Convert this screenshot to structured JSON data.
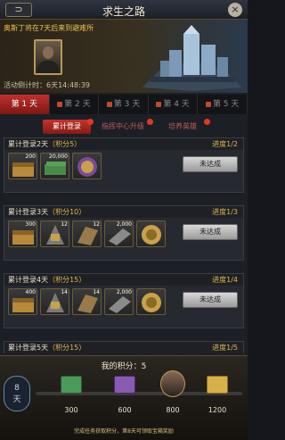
{
  "header": {
    "back_label": "⊃",
    "title": "求生之路",
    "close_label": "×"
  },
  "banner": {
    "message": "奥斯丁将在7天后来到避难所",
    "timer_label": "活动倒计时：",
    "timer_value": "6天14:48:39"
  },
  "day_tabs": [
    {
      "label": "第 1 天",
      "locked": false,
      "active": true
    },
    {
      "label": "第 2 天",
      "locked": true,
      "active": false
    },
    {
      "label": "第 3 天",
      "locked": true,
      "active": false
    },
    {
      "label": "第 4 天",
      "locked": true,
      "active": false
    },
    {
      "label": "第 5 天",
      "locked": true,
      "active": false
    }
  ],
  "sub_tabs": [
    {
      "label": "累计登录",
      "active": true
    },
    {
      "label": "指挥中心升级",
      "active": false
    },
    {
      "label": "培养英雄",
      "active": false
    }
  ],
  "tasks": [
    {
      "title": "累计登录2天",
      "points": "（积分5）",
      "progress": "进度1/2",
      "button": "未达成",
      "items": [
        "200",
        "20,000",
        ""
      ]
    },
    {
      "title": "累计登录3天",
      "points": "（积分10）",
      "progress": "进度1/3",
      "button": "未达成",
      "items": [
        "300",
        "12",
        "12",
        "2,000",
        ""
      ]
    },
    {
      "title": "累计登录4天",
      "points": "（积分15）",
      "progress": "进度1/4",
      "button": "未达成",
      "items": [
        "400",
        "14",
        "14",
        "2,000",
        ""
      ]
    },
    {
      "title": "累计登录5天",
      "points": "（积分15）",
      "progress": "进度1/5",
      "button": "",
      "items": []
    }
  ],
  "bottom": {
    "my_points_label": "我的积分：",
    "my_points_value": "5",
    "day_line1": "8",
    "day_line2": "天",
    "milestones": [
      "300",
      "600",
      "800",
      "1200"
    ],
    "footer": "完成任务获取积分，第8天可领取宝箱奖励"
  },
  "colors": {
    "accent_red": "#c0302a",
    "gold": "#e0b64a"
  }
}
